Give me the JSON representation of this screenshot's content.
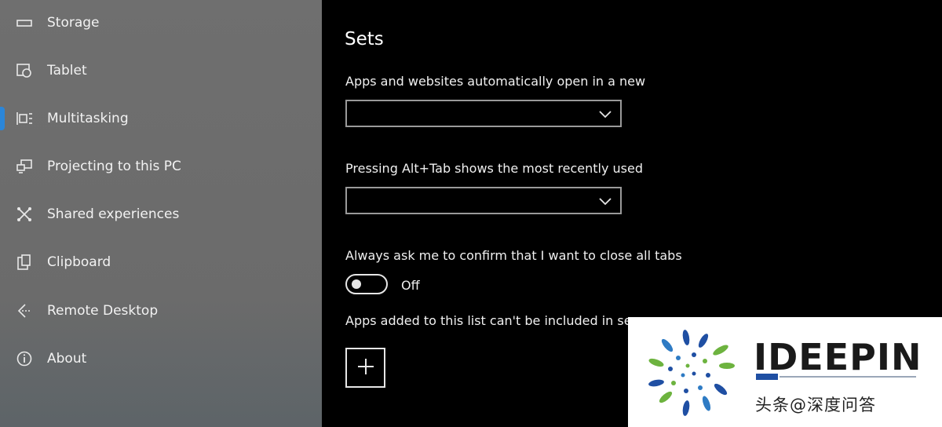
{
  "sidebar": {
    "items": [
      {
        "label": "Storage",
        "icon": "storage-icon"
      },
      {
        "label": "Tablet",
        "icon": "tablet-icon"
      },
      {
        "label": "Multitasking",
        "icon": "multitasking-icon"
      },
      {
        "label": "Projecting to this PC",
        "icon": "projecting-icon"
      },
      {
        "label": "Shared experiences",
        "icon": "shared-experiences-icon"
      },
      {
        "label": "Clipboard",
        "icon": "clipboard-icon"
      },
      {
        "label": "Remote Desktop",
        "icon": "remote-desktop-icon"
      },
      {
        "label": "About",
        "icon": "info-icon"
      }
    ],
    "active_index": 2,
    "accent_color": "#2b86d9"
  },
  "main": {
    "section_title": "Sets",
    "setting1_label": "Apps and websites automatically open in a new",
    "setting1_value": "",
    "setting2_label": "Pressing Alt+Tab shows the most recently used",
    "setting2_value": "",
    "setting3_label": "Always ask me to confirm that I want to close all tabs",
    "toggle_state": "Off",
    "setting4_label": "Apps added to this list can't be included in se"
  },
  "watermark": {
    "brand": "IDEEPIN",
    "caption": "头条@深度问答"
  }
}
